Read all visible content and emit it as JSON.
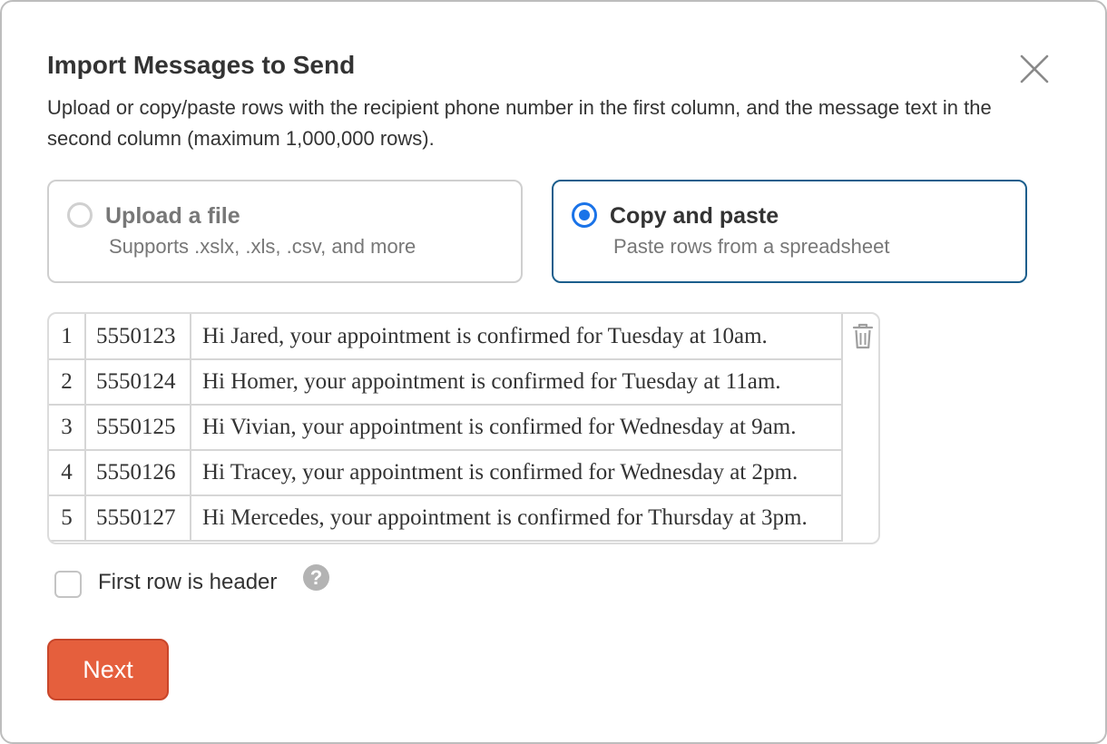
{
  "dialog": {
    "title": "Import Messages to Send",
    "description": "Upload or copy/paste rows with the recipient phone number in the first column, and the message text in the second column (maximum 1,000,000 rows)."
  },
  "options": {
    "upload": {
      "title": "Upload a file",
      "subtitle": "Supports .xslx, .xls, .csv, and more",
      "selected": false
    },
    "paste": {
      "title": "Copy and paste",
      "subtitle": "Paste rows from a spreadsheet",
      "selected": true
    }
  },
  "table": {
    "rows": [
      {
        "index": "1",
        "phone": "5550123",
        "message": "Hi Jared, your appointment is confirmed for Tuesday at 10am."
      },
      {
        "index": "2",
        "phone": "5550124",
        "message": "Hi Homer, your appointment is confirmed for Tuesday at 11am."
      },
      {
        "index": "3",
        "phone": "5550125",
        "message": "Hi Vivian, your appointment is confirmed for Wednesday at 9am."
      },
      {
        "index": "4",
        "phone": "5550126",
        "message": "Hi Tracey, your appointment is confirmed for Wednesday at 2pm."
      },
      {
        "index": "5",
        "phone": "5550127",
        "message": "Hi Mercedes, your appointment is confirmed for Thursday at 3pm."
      }
    ]
  },
  "header_option": {
    "label": "First row is header",
    "checked": false,
    "help_glyph": "?"
  },
  "actions": {
    "next_label": "Next"
  },
  "icons": {
    "close": "close-icon",
    "delete": "trash-icon",
    "help": "help-icon"
  },
  "colors": {
    "accent": "#1a73e8",
    "selected_border": "#1b5e8c",
    "primary_button": "#e55f3d"
  }
}
